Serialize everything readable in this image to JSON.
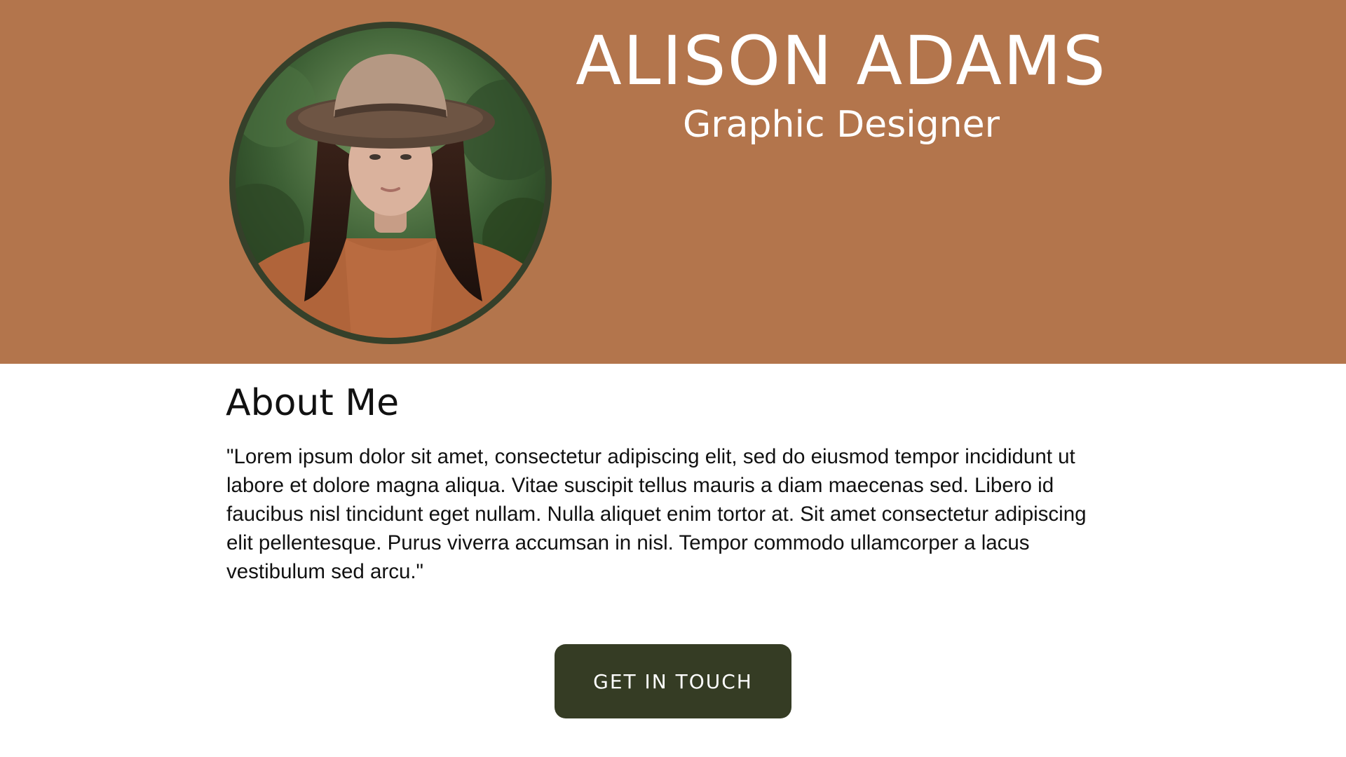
{
  "header": {
    "name": "ALISON ADAMS",
    "title": "Graphic Designer",
    "photo_icon": "portrait-photo"
  },
  "about": {
    "heading": "About Me",
    "body": "\"Lorem ipsum dolor sit amet, consectetur adipiscing elit, sed do eiusmod tempor incididunt ut labore et dolore magna aliqua. Vitae suscipit tellus mauris a diam maecenas sed. Libero id faucibus nisl tincidunt eget nullam. Nulla aliquet enim tortor at. Sit amet consectetur adipiscing elit pellentesque. Purus viverra accumsan in nisl. Tempor commodo ullamcorper a lacus vestibulum sed arcu.\""
  },
  "cta": {
    "label": "GET IN TOUCH"
  },
  "colors": {
    "hero_background": "#b3754c",
    "accent_dark_green": "#353c24",
    "text": "#111111",
    "page_background": "#ffffff"
  }
}
